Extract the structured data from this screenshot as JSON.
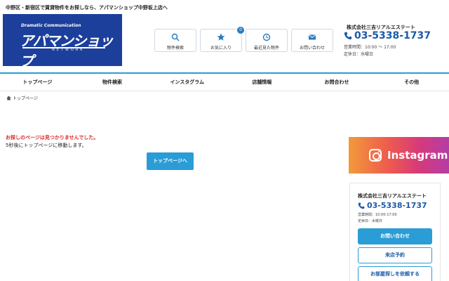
{
  "header": {
    "tagline": "中野区・新宿区で賃貸物件をお探しなら、アパマンショップ中野坂上店へ",
    "logo": {
      "line1": "Dramatic Communication",
      "line2": "アパマンショップ",
      "line3": "NETWORK"
    },
    "buttons": [
      {
        "label": "物件検索",
        "icon": "search-icon"
      },
      {
        "label": "お気に入り",
        "icon": "star-icon",
        "badge": "0"
      },
      {
        "label": "最近見た物件",
        "icon": "history-icon"
      },
      {
        "label": "お問い合わせ",
        "icon": "mail-icon"
      }
    ],
    "company": "株式会社三吉リアルエステート",
    "phone": "03-5338-1737",
    "hours": "営業時間：10:00 〜 17:00",
    "closed": "定休日：水曜日"
  },
  "nav": {
    "items": [
      "トップページ",
      "物件検索",
      "インスタグラム",
      "店舗情報",
      "お問合わせ",
      "その他"
    ]
  },
  "breadcrumb": {
    "label": "トップページ"
  },
  "main": {
    "error_message": "お探しのページは見つかりませんでした。",
    "redirect_message": "5秒後にトップページに移動します。",
    "top_button_label": "トップページへ"
  },
  "sidebar": {
    "instagram_label": "Instagram",
    "shop": {
      "name": "株式会社三吉リアルエステート",
      "phone": "03-5338-1737",
      "hours": "営業時間：10:00-17:00",
      "closed": "定休日：水曜日",
      "contact_label": "お問い合わせ",
      "visit_label": "来店予約",
      "request_label": "お部屋探しを依頼する"
    }
  },
  "colors": {
    "brand_blue": "#1c3f9c",
    "accent_blue": "#2a9cd6",
    "error_red": "#e02a2a"
  }
}
